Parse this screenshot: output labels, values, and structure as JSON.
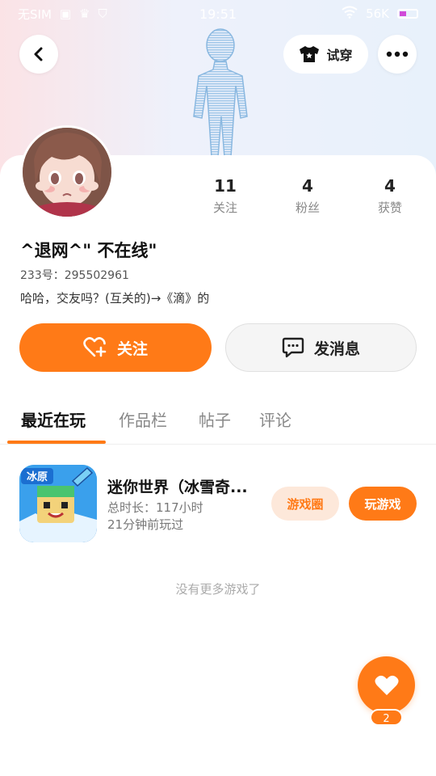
{
  "statusbar": {
    "carrier": "无SIM",
    "time": "19:51",
    "network": "56K"
  },
  "header": {
    "tryon_label": "试穿"
  },
  "profile": {
    "stats": [
      {
        "value": "11",
        "label": "关注"
      },
      {
        "value": "4",
        "label": "粉丝"
      },
      {
        "value": "4",
        "label": "获赞"
      }
    ],
    "username": "^退网^\" 不在线\"",
    "uid": "233号：295502961",
    "bio": "哈哈，交友吗？(互关的)→《滴》的"
  },
  "actions": {
    "follow_label": "关注",
    "message_label": "发消息"
  },
  "tabs": [
    {
      "label": "最近在玩"
    },
    {
      "label": "作品栏"
    },
    {
      "label": "帖子"
    },
    {
      "label": "评论"
    }
  ],
  "games": [
    {
      "title": "迷你世界（冰雪奇...",
      "playtime": "总时长：117小时",
      "last_played": "21分钟前玩过",
      "circle_label": "游戏圈",
      "play_label": "玩游戏",
      "icon_text": "冰原"
    }
  ],
  "no_more_text": "没有更多游戏了",
  "likes": {
    "count": "2"
  },
  "colors": {
    "accent": "#ff7a17",
    "accent_light": "#fde8da"
  }
}
